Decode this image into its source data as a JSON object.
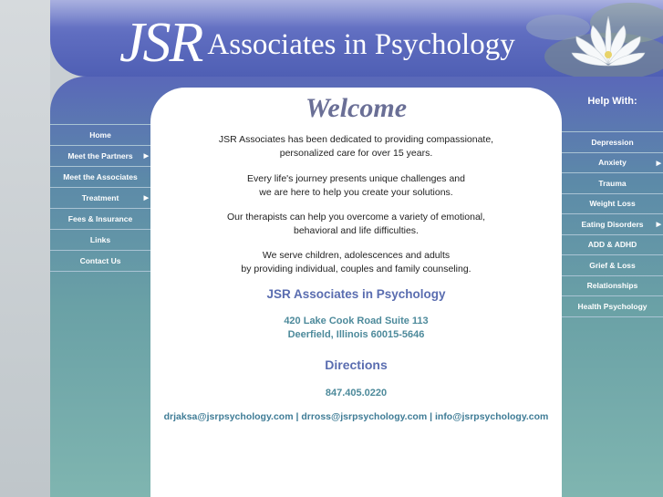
{
  "header": {
    "logo_mark": "JSR",
    "logo_text": "Associates in Psychology"
  },
  "left_nav": [
    {
      "label": "Home",
      "has_submenu": false
    },
    {
      "label": "Meet the Partners",
      "has_submenu": true
    },
    {
      "label": "Meet the Associates",
      "has_submenu": false
    },
    {
      "label": "Treatment",
      "has_submenu": true
    },
    {
      "label": "Fees & Insurance",
      "has_submenu": false
    },
    {
      "label": "Links",
      "has_submenu": false
    },
    {
      "label": "Contact Us",
      "has_submenu": false
    }
  ],
  "main": {
    "welcome": "Welcome",
    "para1_line1": "JSR Associates has been dedicated to providing compassionate,",
    "para1_line2": "personalized care for over 15 years.",
    "para2_line1": "Every life's journey presents unique challenges and",
    "para2_line2": "we are here to help you create your solutions.",
    "para3_line1": "Our therapists can help you overcome a variety of emotional,",
    "para3_line2": "behavioral and life difficulties.",
    "para4_line1": "We serve children, adolescences and adults",
    "para4_line2": "by providing individual, couples and family counseling.",
    "org_name": "JSR Associates in Psychology",
    "address_line1": "420 Lake Cook Road Suite 113",
    "address_line2": "Deerfield, Illinois 60015-5646",
    "directions": "Directions",
    "phone": "847.405.0220",
    "email1": "drjaksa@jsrpsychology.com",
    "email2": "drross@jsrpsychology.com",
    "email3": "info@jsrpsychology.com",
    "email_separator": "|"
  },
  "right_nav": {
    "title": "Help With:",
    "items": [
      {
        "label": "Depression",
        "has_submenu": false
      },
      {
        "label": "Anxiety",
        "has_submenu": true
      },
      {
        "label": "Trauma",
        "has_submenu": false
      },
      {
        "label": "Weight Loss",
        "has_submenu": false
      },
      {
        "label": "Eating Disorders",
        "has_submenu": true
      },
      {
        "label": "ADD & ADHD",
        "has_submenu": false
      },
      {
        "label": "Grief & Loss",
        "has_submenu": false
      },
      {
        "label": "Relationships",
        "has_submenu": false
      },
      {
        "label": "Health Psychology",
        "has_submenu": false
      }
    ]
  },
  "colors": {
    "header_blue": "#5f6dc0",
    "accent_teal": "#4d8a9b",
    "title_blue": "#5a6db0",
    "welcome_gray": "#6a6f96"
  },
  "icons": {
    "submenu": "triangle-right-icon",
    "logo_image": "water-lily-icon"
  }
}
